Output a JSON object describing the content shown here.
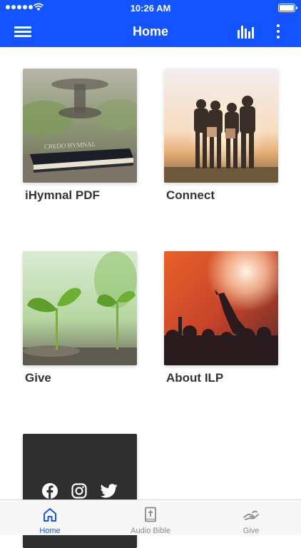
{
  "status_bar": {
    "time": "10:26 AM"
  },
  "header": {
    "title": "Home"
  },
  "cards": [
    {
      "label": "iHymnal PDF",
      "book_text": "CREDO HYMNAL"
    },
    {
      "label": "Connect"
    },
    {
      "label": "Give"
    },
    {
      "label": "About ILP"
    }
  ],
  "social": {
    "icons": [
      "facebook-icon",
      "instagram-icon",
      "twitter-icon"
    ]
  },
  "tabbar": {
    "items": [
      {
        "label": "Home",
        "icon": "home-icon",
        "active": true
      },
      {
        "label": "Audio Bible",
        "icon": "bible-icon",
        "active": false
      },
      {
        "label": "Give",
        "icon": "give-hand-icon",
        "active": false
      }
    ]
  },
  "colors": {
    "primary": "#1454ff",
    "tab_inactive": "#8a8a8a",
    "social_card": "#2f2f2f"
  }
}
